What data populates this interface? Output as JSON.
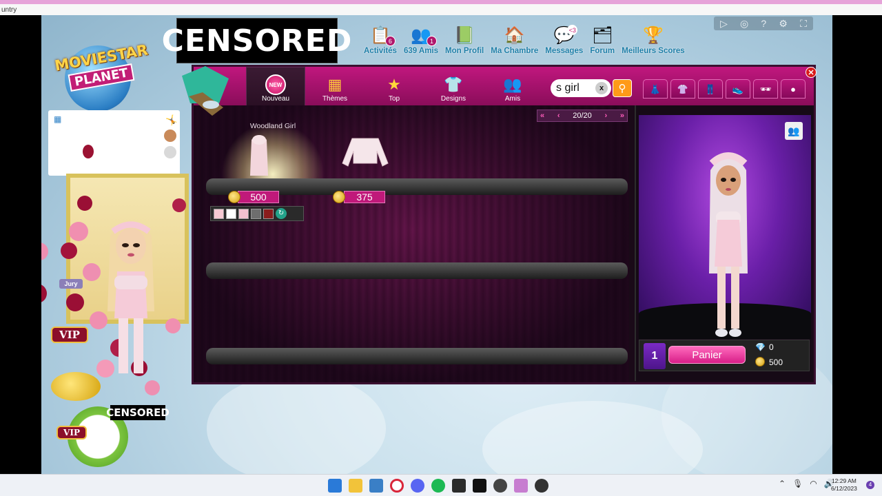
{
  "browser": {
    "url_fragment": "untry"
  },
  "header": {
    "logo_line1": "MOVIESTAR",
    "logo_line2": "PLANET",
    "censor_label": "CENSORED"
  },
  "nav": [
    {
      "label": "Activités",
      "icon": "clipboard-icon",
      "badge": "6"
    },
    {
      "label": "639 Amis",
      "icon": "friends-icon",
      "badge": "1"
    },
    {
      "label": "Mon Profil",
      "icon": "profile-book-icon",
      "badge": ""
    },
    {
      "label": "Ma Chambre",
      "icon": "house-icon",
      "badge": ""
    },
    {
      "label": "Messages",
      "icon": "speech-bubble-icon",
      "badge": "<3"
    },
    {
      "label": "Forum",
      "icon": "forum-icon",
      "badge": ""
    },
    {
      "label": "Meilleurs Scores",
      "icon": "trophy-icon",
      "badge": ""
    }
  ],
  "sidebar": {
    "jury_label": "Jury",
    "vip_label": "VIP",
    "vip_label2": "VIP",
    "censor_small": "CENSORED"
  },
  "shop": {
    "tabs": [
      {
        "label": "Nouveau",
        "badge": "NEW",
        "active": true
      },
      {
        "label": "Thèmes"
      },
      {
        "label": "Top"
      },
      {
        "label": "Designs"
      },
      {
        "label": "Amis"
      }
    ],
    "search": {
      "value": "s girl",
      "clear": "x"
    },
    "pager": {
      "text": "20/20"
    },
    "items": [
      {
        "name": "Woodland Girl",
        "price": "500"
      },
      {
        "name": "",
        "price": "375"
      }
    ],
    "swatches": [
      "#f6c9d3",
      "#ffffff",
      "#f4c1cf",
      "#6e6e6e",
      "#8a1c1c"
    ],
    "cart": {
      "count": "1",
      "button": "Panier",
      "diamonds": "0",
      "coins": "500"
    }
  },
  "taskbar": {
    "time": "12:29 AM",
    "date": "6/12/2023",
    "notifications": "4"
  }
}
